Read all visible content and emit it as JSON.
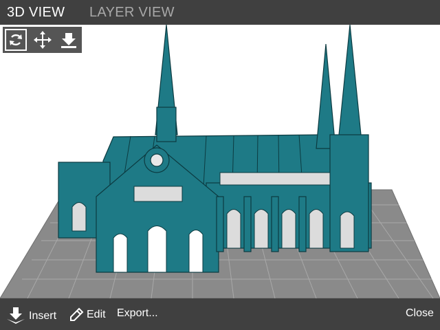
{
  "tabs": [
    {
      "label": "3D VIEW",
      "active": true
    },
    {
      "label": "LAYER VIEW",
      "active": false
    }
  ],
  "toolbar": {
    "tools": [
      {
        "icon": "rotate-icon",
        "selected": true
      },
      {
        "icon": "move-icon",
        "selected": false
      },
      {
        "icon": "lay-flat-icon",
        "selected": false
      }
    ]
  },
  "viewport": {
    "model_color": "#1e7a86",
    "bed_color": "#8a8a8a",
    "grid_color": "#b0b0b0"
  },
  "bottom": {
    "insert_label": "Insert",
    "edit_label": "Edit",
    "export_label": "Export...",
    "close_label": "Close"
  },
  "colors": {
    "bar_bg": "#404040",
    "tab_active": "#ffffff",
    "tab_inactive": "#a8a8a8"
  }
}
